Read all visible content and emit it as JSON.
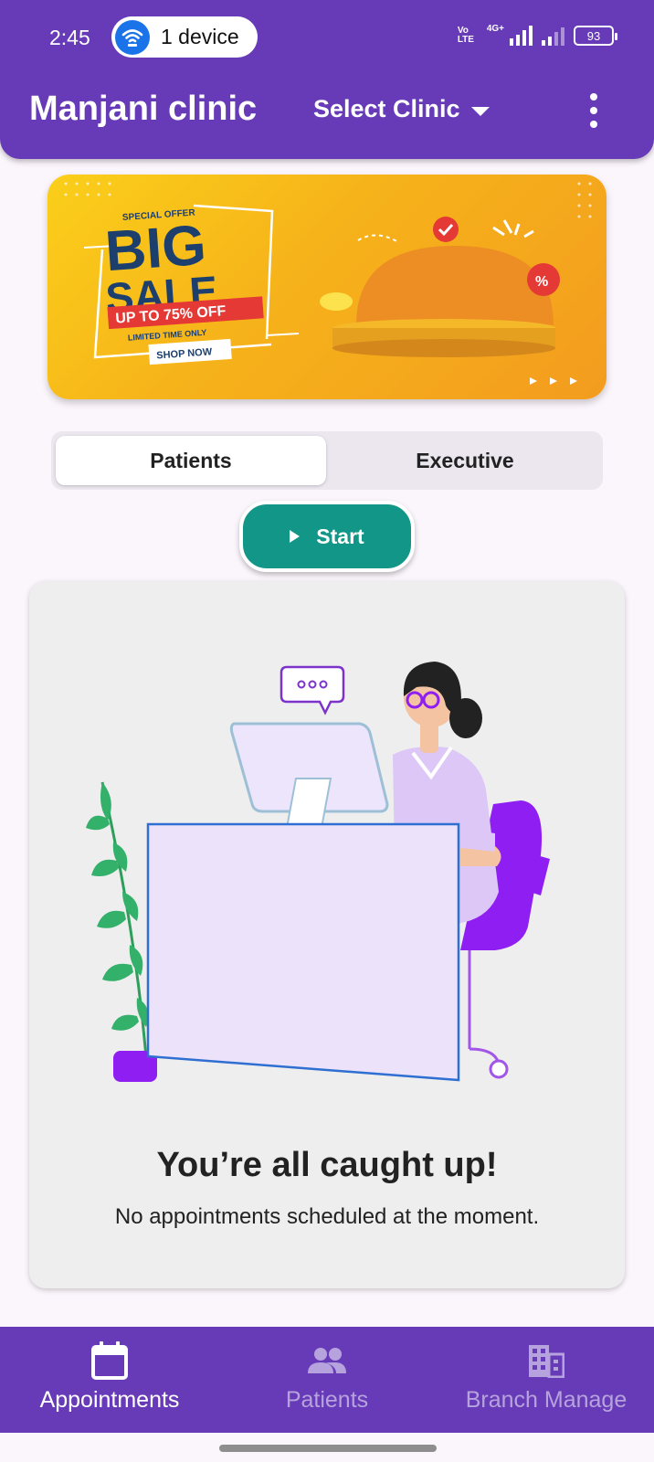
{
  "status_bar": {
    "time": "2:45",
    "hotspot_label": "1 device",
    "volte": "Vo LTE",
    "network": "4G+",
    "battery": "93"
  },
  "app_bar": {
    "title": "Manjani clinic",
    "select_clinic_label": "Select Clinic"
  },
  "banner": {
    "special_offer": "SPECIAL OFFER",
    "big": "BIG",
    "sale": "SALE",
    "discount": "UP TO 75% OFF",
    "limited": "LIMITED TIME ONLY",
    "shop_now": "SHOP NOW",
    "percent_badge": "%"
  },
  "tabs": [
    {
      "label": "Patients",
      "active": true
    },
    {
      "label": "Executive",
      "active": false
    }
  ],
  "start_button": {
    "label": "Start"
  },
  "empty_state": {
    "title": "You’re all caught up!",
    "subtitle": "No appointments scheduled at the moment."
  },
  "bottom_nav": [
    {
      "label": "Appointments",
      "icon": "calendar-icon",
      "active": true
    },
    {
      "label": "Patients",
      "icon": "people-icon",
      "active": false
    },
    {
      "label": "Branch Manage",
      "icon": "building-icon",
      "active": false
    }
  ],
  "colors": {
    "primary": "#673ab7",
    "start_button": "#119688",
    "inactive_nav": "#b6a3de"
  }
}
